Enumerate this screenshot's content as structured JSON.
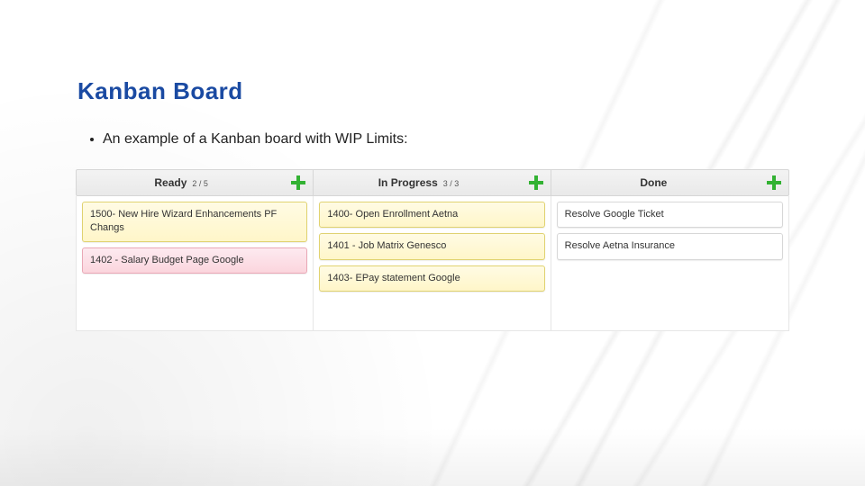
{
  "title": "Kanban Board",
  "bullet_text": "An example of a Kanban board with WIP Limits:",
  "columns": [
    {
      "label": "Ready",
      "wip": "2 / 5",
      "cards": [
        {
          "text": "1500- New Hire Wizard Enhancements PF Changs",
          "style": "yellow"
        },
        {
          "text": "1402 - Salary Budget Page Google",
          "style": "pink"
        }
      ]
    },
    {
      "label": "In Progress",
      "wip": "3 / 3",
      "cards": [
        {
          "text": "1400- Open Enrollment Aetna",
          "style": "yellow"
        },
        {
          "text": "1401 - Job Matrix Genesco",
          "style": "yellow"
        },
        {
          "text": "1403- EPay statement Google",
          "style": "yellow"
        }
      ]
    },
    {
      "label": "Done",
      "wip": "",
      "cards": [
        {
          "text": "Resolve Google Ticket",
          "style": "white"
        },
        {
          "text": "Resolve Aetna Insurance",
          "style": "white"
        }
      ]
    }
  ]
}
